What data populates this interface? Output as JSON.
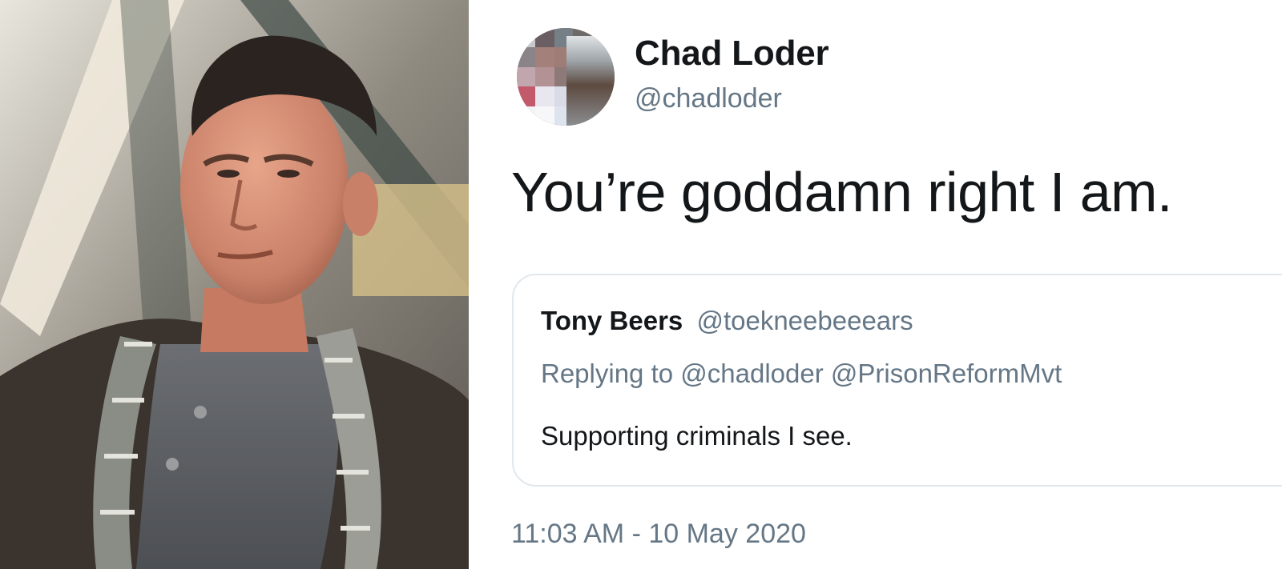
{
  "tweet": {
    "author": {
      "name": "Chad Loder",
      "handle": "@chadloder"
    },
    "text": "You’re goddamn right I am.",
    "quoted": {
      "name": "Tony Beers",
      "handle": "@toekneebeeears",
      "replying_prefix": "Replying to",
      "replying_to": "@chadloder @PrisonReformMvt",
      "text": "Supporting criminals I see."
    },
    "timestamp": "11:03 AM - 10 May 2020"
  },
  "colors": {
    "primary_text": "#14171a",
    "secondary_text": "#657786",
    "border": "#e1e8ed",
    "background": "#ffffff"
  },
  "icons": {
    "avatar": "pixelated-avatar-icon"
  }
}
